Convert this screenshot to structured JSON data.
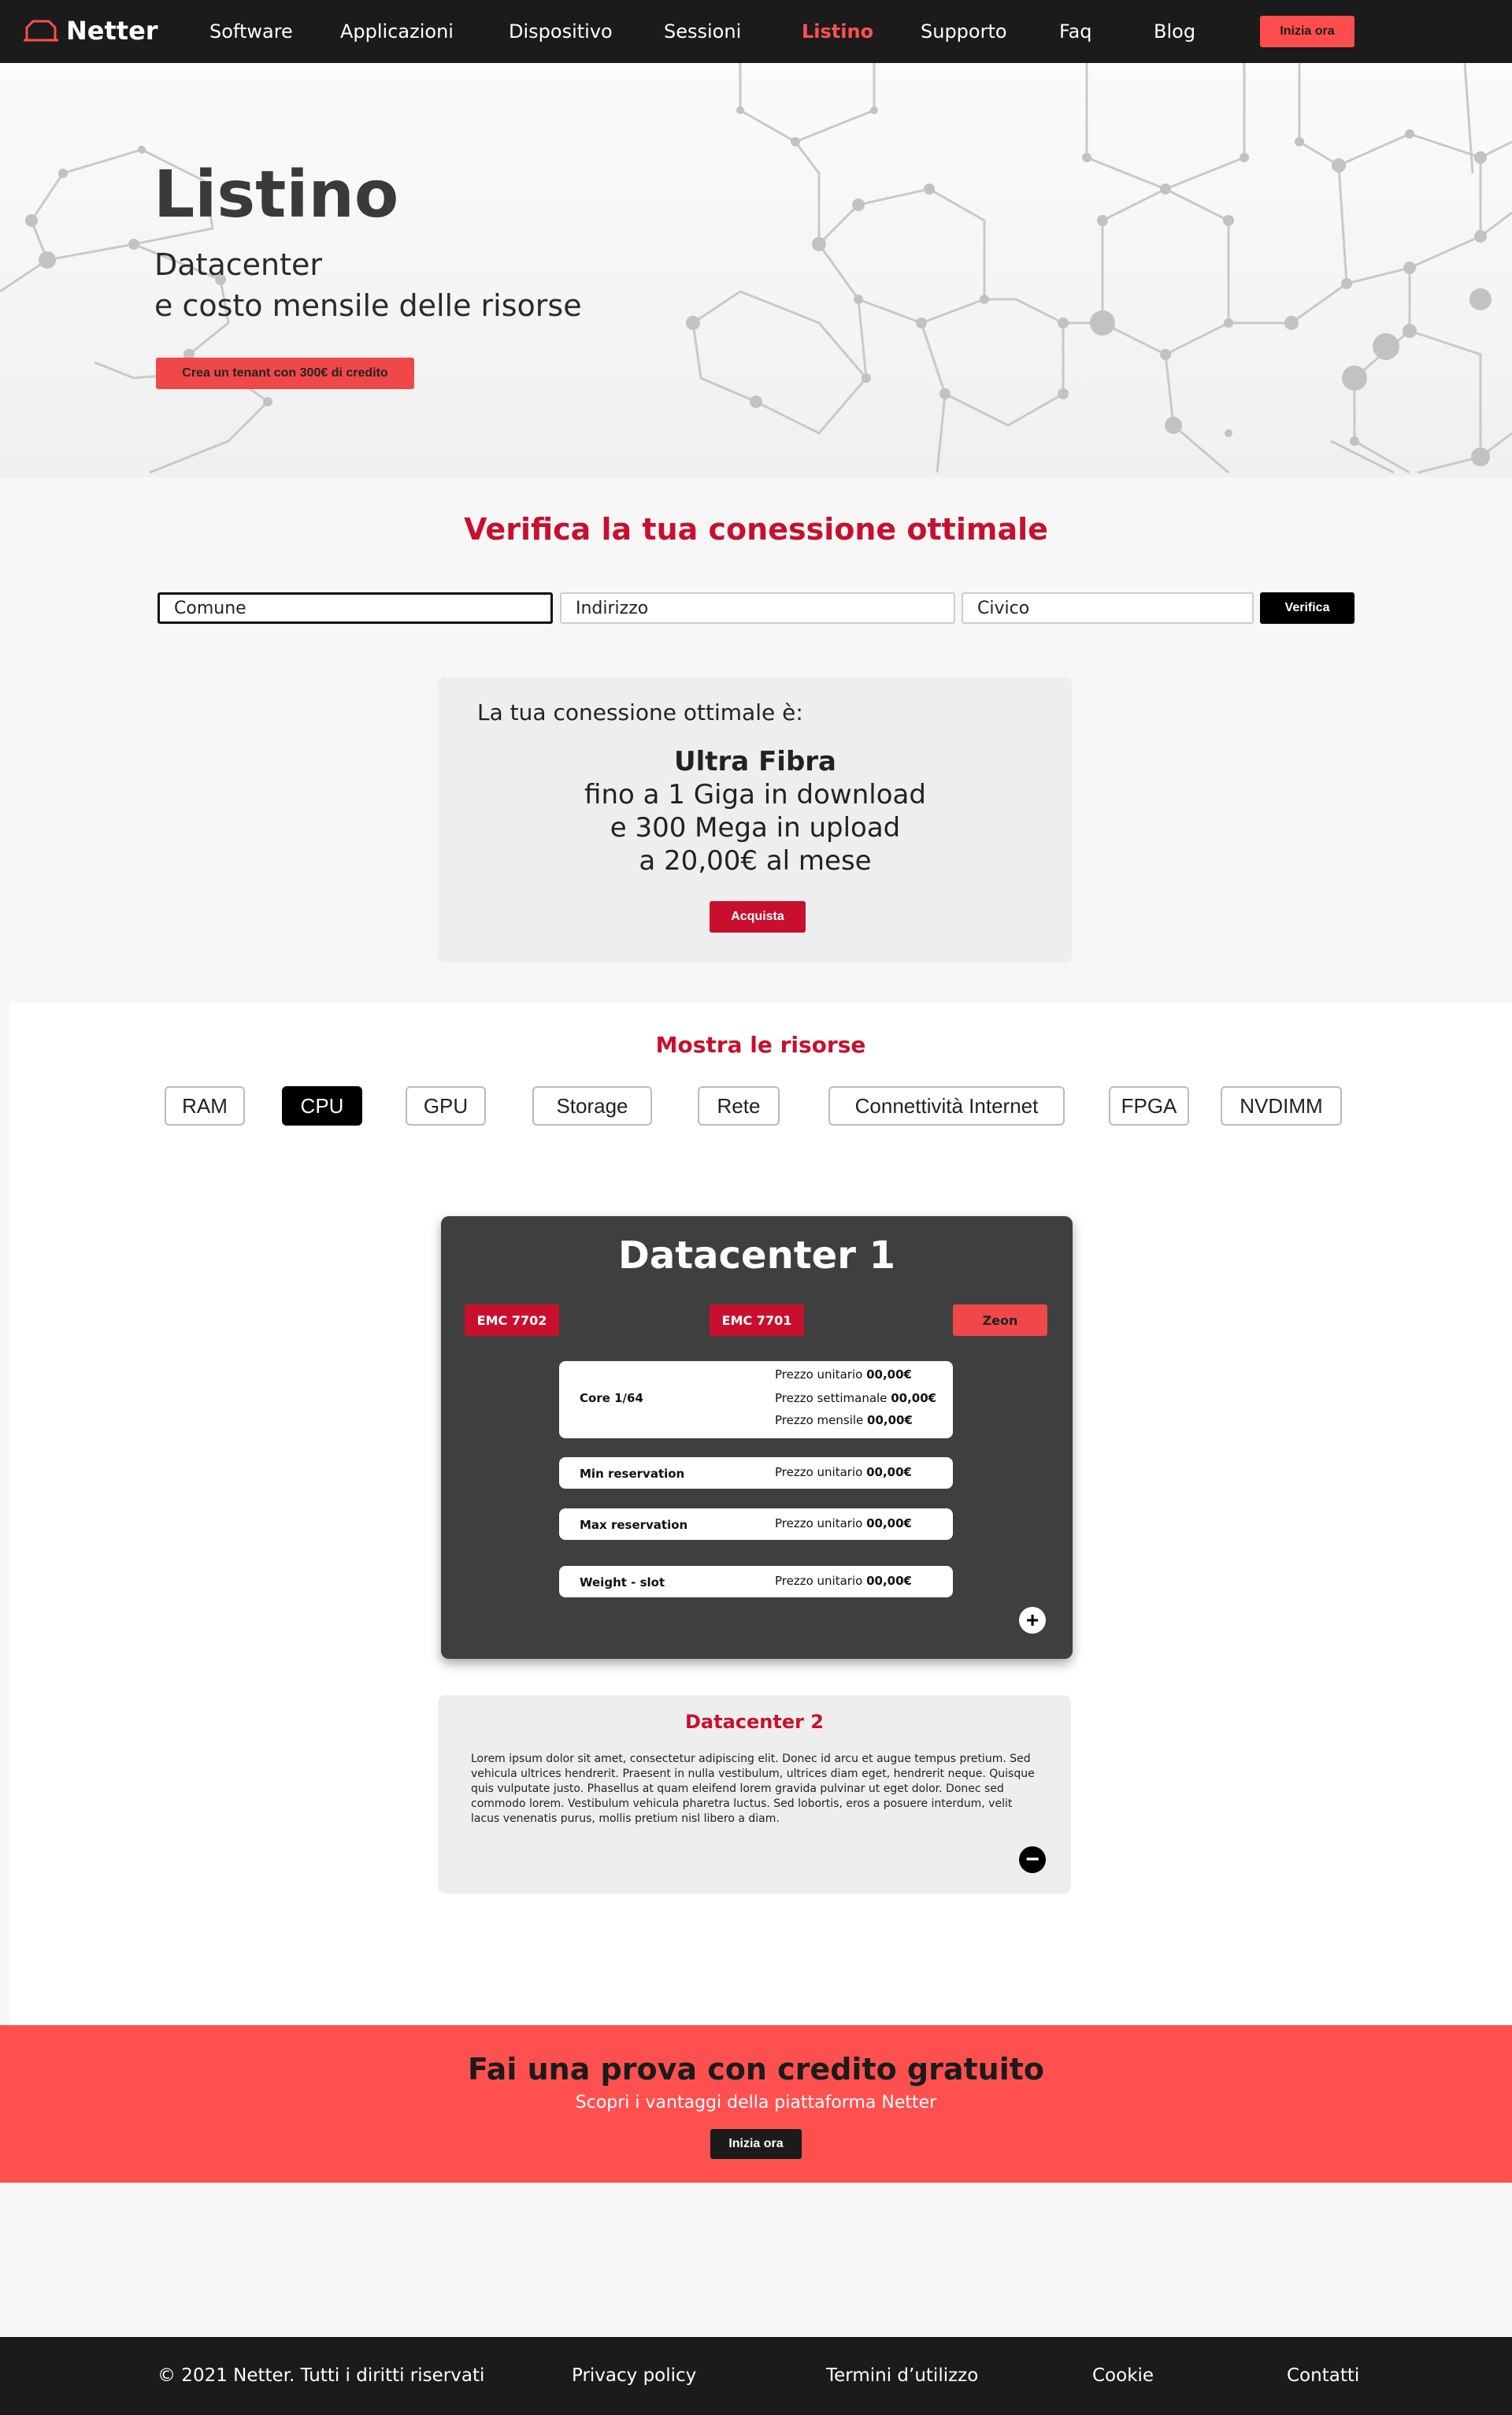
{
  "nav": {
    "brand": "Netter",
    "links": [
      "Software",
      "Applicazioni",
      "Dispositivo",
      "Sessioni",
      "Listino",
      "Supporto",
      "Faq",
      "Blog"
    ],
    "active": "Listino",
    "cta": "Inizia ora"
  },
  "hero": {
    "title": "Listino",
    "subtitle_line1": "Datacenter",
    "subtitle_line2": "e costo mensile delle risorse",
    "button": "Crea un tenant con 300€ di credito"
  },
  "verify": {
    "title": "Verifica la tua conessione ottimale",
    "comune_placeholder": "Comune",
    "indirizzo_placeholder": "Indirizzo",
    "civico_placeholder": "Civico",
    "button": "Verifica"
  },
  "result": {
    "lead": "La tua conessione ottimale è:",
    "product": "Ultra Fibra",
    "line1": "fino a 1 Giga in download",
    "line2": "e 300 Mega in upload",
    "line3": "a 20,00€ al mese",
    "button": "Acquista"
  },
  "resources": {
    "title": "Mostra le risorse",
    "tabs": [
      "RAM",
      "CPU",
      "GPU",
      "Storage",
      "Rete",
      "Connettività Internet",
      "FPGA",
      "NVDIMM"
    ],
    "active": "CPU"
  },
  "datacenter1": {
    "title": "Datacenter 1",
    "tags": [
      "EMC 7702",
      "EMC 7701",
      "Zeon"
    ],
    "core": {
      "label": "Core 1/64",
      "p1_label": "Prezzo unitario",
      "p1_value": "00,00€",
      "p2_label": "Prezzo settimanale",
      "p2_value": "00,00€",
      "p3_label": "Prezzo mensile",
      "p3_value": "00,00€"
    },
    "min": {
      "label": "Min reservation",
      "price_label": "Prezzo unitario",
      "price_value": "00,00€"
    },
    "max": {
      "label": "Max reservation",
      "price_label": "Prezzo unitario",
      "price_value": "00,00€"
    },
    "weight": {
      "label": "Weight - slot",
      "price_label": "Prezzo unitario",
      "price_value": "00,00€"
    },
    "expand": "+"
  },
  "datacenter2": {
    "title": "Datacenter 2",
    "text": "Lorem ipsum dolor sit amet, consectetur adipiscing elit. Donec id arcu et augue tempus pretium. Sed vehicula ultrices hendrerit. Praesent in nulla vestibulum, ultrices diam eget, hendrerit neque. Quisque quis vulputate justo. Phasellus at quam eleifend lorem gravida pulvinar ut eget dolor. Donec sed commodo lorem. Vestibulum vehicula pharetra luctus. Sed lobortis, eros a posuere interdum, velit lacus venenatis purus, mollis pretium nisl libero a diam.",
    "collapse": "−"
  },
  "cta": {
    "title": "Fai una prova con credito gratuito",
    "subtitle": "Scopri i vantaggi della piattaforma Netter",
    "button": "Inizia ora"
  },
  "footer": {
    "copyright": "© 2021 Netter. Tutti i diritti riservati",
    "privacy": "Privacy policy",
    "terms": "Termini d’utilizzo",
    "cookie": "Cookie",
    "contacts": "Contatti"
  },
  "colors": {
    "brand_red": "#c8102e",
    "accent_red": "#ff5050",
    "dark": "#1b1b1b"
  }
}
